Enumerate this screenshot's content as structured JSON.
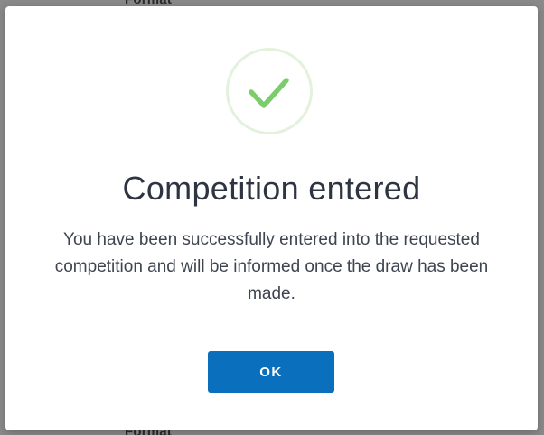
{
  "background": {
    "top_label": "Format",
    "bottom_label": "Format"
  },
  "dialog": {
    "icon": "check-circle-icon",
    "title": "Competition entered",
    "message": "You have been successfully entered into the requested competition and will be informed once the draw has been made.",
    "ok_label": "OK"
  },
  "colors": {
    "accent": "#0a6fbd",
    "success": "#7ccc6c",
    "success_ring": "#e3f2dc"
  }
}
